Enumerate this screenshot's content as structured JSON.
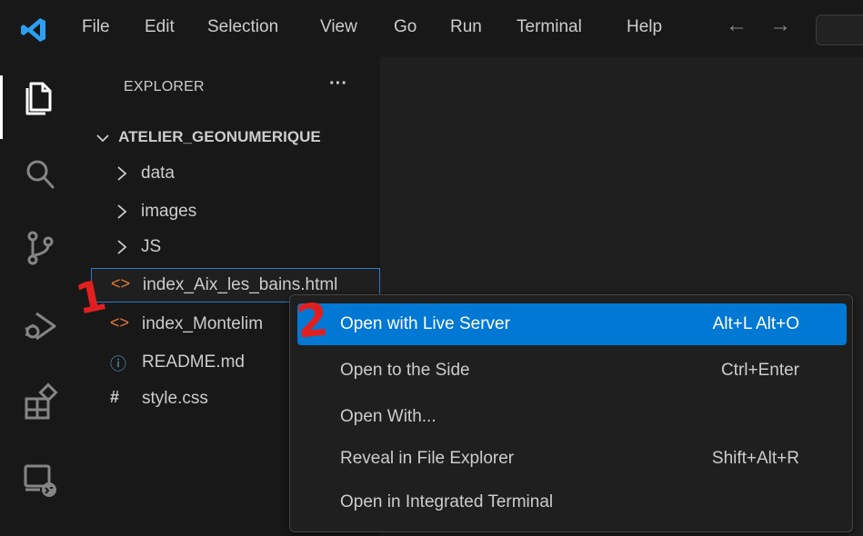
{
  "menu": [
    "File",
    "Edit",
    "Selection",
    "View",
    "Go",
    "Run",
    "Terminal",
    "Help"
  ],
  "nav": {
    "back": "←",
    "forward": "→"
  },
  "sidebar": {
    "title": "EXPLORER",
    "more": "···",
    "root": "ATELIER_GEONUMERIQUE",
    "items": [
      {
        "type": "folder",
        "label": "data"
      },
      {
        "type": "folder",
        "label": "images"
      },
      {
        "type": "folder",
        "label": "JS"
      },
      {
        "type": "html",
        "icon": "<>",
        "label": "index_Aix_les_bains.html"
      },
      {
        "type": "html",
        "icon": "<>",
        "label": "index_Montelim"
      },
      {
        "type": "info",
        "icon": "ⓘ",
        "label": "README.md"
      },
      {
        "type": "css",
        "icon": "#",
        "label": "style.css"
      }
    ]
  },
  "context_menu": {
    "items": [
      {
        "label": "Open with Live Server",
        "shortcut": "Alt+L Alt+O"
      },
      {
        "label": "Open to the Side",
        "shortcut": "Ctrl+Enter"
      },
      {
        "label": "Open With...",
        "shortcut": ""
      },
      {
        "label": "Reveal in File Explorer",
        "shortcut": "Shift+Alt+R"
      },
      {
        "label": "Open in Integrated Terminal",
        "shortcut": ""
      }
    ]
  },
  "annotations": {
    "step1": "1",
    "step2": "2"
  },
  "colors": {
    "accent": "#0078d4",
    "selection_border": "#2b79d0",
    "annotation": "#e02020",
    "html_icon": "#e37933",
    "info_icon": "#519aba",
    "css_icon": "#cccccc"
  }
}
